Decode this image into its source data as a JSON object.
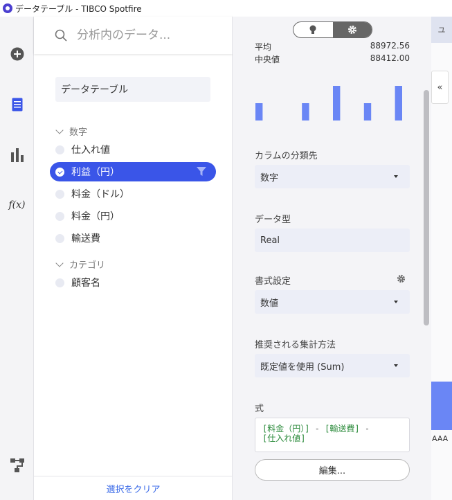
{
  "window": {
    "title": "データテーブル - TIBCO Spotfire"
  },
  "rail": {
    "icons": [
      "add-icon",
      "data-table-icon",
      "bar-chart-icon",
      "function-icon",
      "hierarchy-icon"
    ],
    "function_glyph": "f(x)"
  },
  "data_panel": {
    "search_placeholder": "分析内のデータ...",
    "table_name": "データテーブル",
    "groups": [
      {
        "label": "数字",
        "items": [
          "仕入れ値",
          "利益（円）",
          "料金（ドル）",
          "料金（円）",
          "輸送費"
        ]
      },
      {
        "label": "カテゴリ",
        "items": [
          "顧客名"
        ]
      }
    ],
    "selected_item": "利益（円）",
    "clear_selection": "選択をクリア"
  },
  "properties": {
    "stats": [
      {
        "label": "平均",
        "value": "88972.56"
      },
      {
        "label": "中央値",
        "value": "88412.00"
      }
    ],
    "histogram": {
      "values": [
        24,
        0,
        0,
        24,
        0,
        48,
        0,
        24,
        0,
        48
      ],
      "color": "#6a86f5"
    },
    "column_class_label": "カラムの分類先",
    "column_class_value": "数字",
    "data_type_label": "データ型",
    "data_type_value": "Real",
    "format_label": "書式設定",
    "format_value": "数値",
    "aggregation_label": "推奨される集計方法",
    "aggregation_value": "既定値を使用 (Sum)",
    "expression_label": "式",
    "expression": {
      "part1": "[料金（円）]",
      "op1": " - ",
      "part2": "[輸送費]",
      "op2": " -",
      "part3": "[仕入れ値]"
    },
    "edit_button": "編集..."
  },
  "background": {
    "tab_label": "ユ",
    "collapse_glyph": "«",
    "axis_text": "AAA"
  },
  "colors": {
    "accent": "#3a55e8",
    "bar": "#6a86f5",
    "expression": "#2a8a3a"
  }
}
